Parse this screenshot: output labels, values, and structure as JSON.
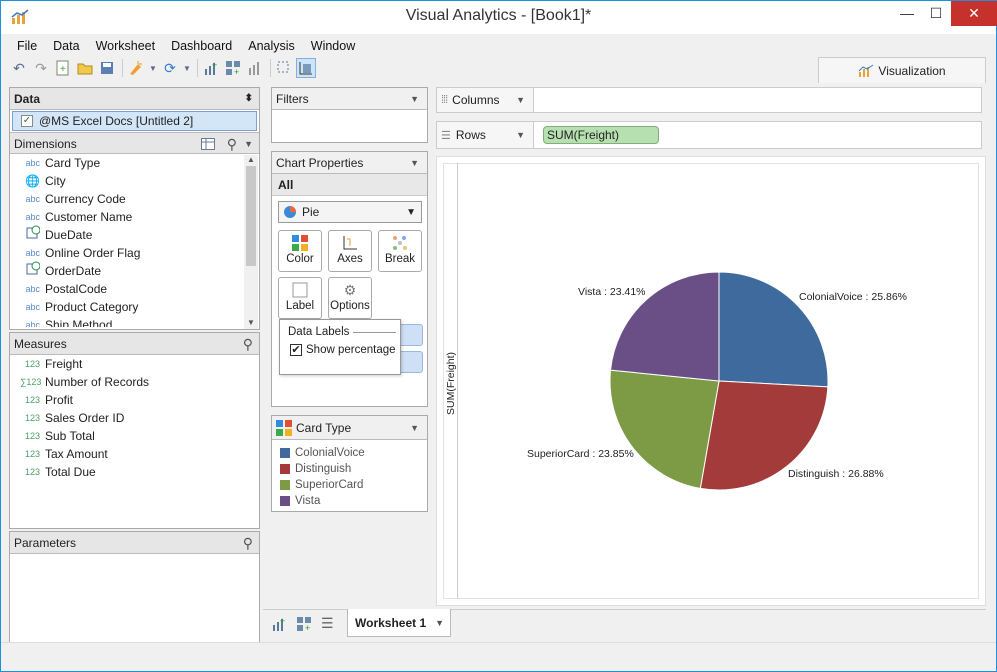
{
  "window": {
    "title": "Visual Analytics - [Book1]*",
    "minimize": "—",
    "maximize": "☐",
    "close": "✕"
  },
  "menu": [
    "File",
    "Data",
    "Worksheet",
    "Dashboard",
    "Analysis",
    "Window"
  ],
  "visualization_tab": "Visualization",
  "data_panel": {
    "title": "Data",
    "source": "@MS Excel Docs [Untitled 2]"
  },
  "dimensions": {
    "title": "Dimensions",
    "items": [
      {
        "tag": "abc",
        "label": "Card Type"
      },
      {
        "tag": "geo",
        "label": "City"
      },
      {
        "tag": "abc",
        "label": "Currency Code"
      },
      {
        "tag": "abc",
        "label": "Customer Name"
      },
      {
        "tag": "date",
        "label": "DueDate"
      },
      {
        "tag": "abc",
        "label": "Online Order Flag"
      },
      {
        "tag": "date",
        "label": "OrderDate"
      },
      {
        "tag": "abc",
        "label": "PostalCode"
      },
      {
        "tag": "abc",
        "label": "Product Category"
      },
      {
        "tag": "abc",
        "label": "Ship Method"
      }
    ]
  },
  "measures": {
    "title": "Measures",
    "items": [
      {
        "tag": "123",
        "label": "Freight"
      },
      {
        "tag": "x123",
        "label": "Number of Records"
      },
      {
        "tag": "123",
        "label": "Profit"
      },
      {
        "tag": "123",
        "label": "Sales Order ID"
      },
      {
        "tag": "123",
        "label": "Sub Total"
      },
      {
        "tag": "123",
        "label": "Tax Amount"
      },
      {
        "tag": "123",
        "label": "Total Due"
      }
    ]
  },
  "parameters": {
    "title": "Parameters"
  },
  "filters": {
    "title": "Filters"
  },
  "chart_properties": {
    "title": "Chart Properties",
    "all": "All",
    "chart_type": "Pie",
    "buttons": {
      "color": "Color",
      "axes": "Axes",
      "break": "Break",
      "label": "Label",
      "options": "Options"
    }
  },
  "data_labels_popup": {
    "title": "Data Labels",
    "show_percentage": "Show percentage",
    "checked": true
  },
  "legend": {
    "title": "Card Type",
    "items": [
      {
        "label": "ColonialVoice",
        "color": "#3e6a9e"
      },
      {
        "label": "Distinguish",
        "color": "#a33b3b"
      },
      {
        "label": "SuperiorCard",
        "color": "#7d9a45"
      },
      {
        "label": "Vista",
        "color": "#6a4f87"
      }
    ]
  },
  "shelves": {
    "columns": "Columns",
    "rows": "Rows",
    "rows_pill": "SUM(Freight)"
  },
  "chart_data": {
    "type": "pie",
    "ylabel": "SUM(Freight)",
    "slices": [
      {
        "label": "ColonialVoice",
        "value": 25.86,
        "text": "ColonialVoice : 25.86%",
        "color": "#3e6a9e"
      },
      {
        "label": "Distinguish",
        "value": 26.88,
        "text": "Distinguish : 26.88%",
        "color": "#a33b3b"
      },
      {
        "label": "SuperiorCard",
        "value": 23.85,
        "text": "SuperiorCard : 23.85%",
        "color": "#7d9a45"
      },
      {
        "label": "Vista",
        "value": 23.41,
        "text": "Vista : 23.41%",
        "color": "#6a4f87"
      }
    ]
  },
  "sheet_tab": "Worksheet 1"
}
